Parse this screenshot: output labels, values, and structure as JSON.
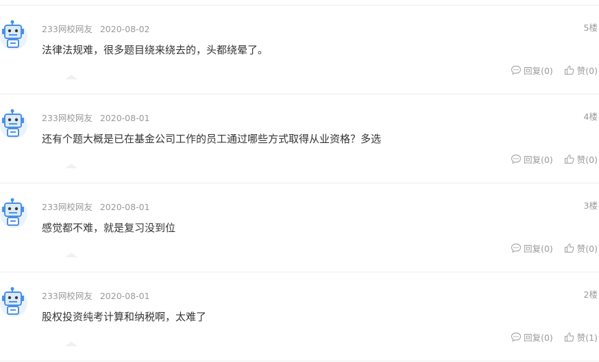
{
  "comments": [
    {
      "user": "233网校网友",
      "date": "2020-08-02",
      "floor": "5楼",
      "text": "法律法规难，很多题目绕来绕去的，头都绕晕了。",
      "reply_label": "回复(0)",
      "like_label": "赞(0)"
    },
    {
      "user": "233网校网友",
      "date": "2020-08-01",
      "floor": "4楼",
      "text": "还有个题大概是已在基金公司工作的员工通过哪些方式取得从业资格？多选",
      "reply_label": "回复(0)",
      "like_label": "赞(0)"
    },
    {
      "user": "233网校网友",
      "date": "2020-08-01",
      "floor": "3楼",
      "text": "感觉都不难，就是复习没到位",
      "reply_label": "回复(0)",
      "like_label": "赞(0)"
    },
    {
      "user": "233网校网友",
      "date": "2020-08-01",
      "floor": "2楼",
      "text": "股权投资纯考计算和纳税啊，太难了",
      "reply_label": "回复(0)",
      "like_label": "赞(1)"
    }
  ],
  "icons": {
    "avatar": "robot-avatar-icon",
    "reply": "comment-bubble-icon",
    "like": "thumbs-up-icon"
  },
  "colors": {
    "meta": "#999999",
    "text": "#333333",
    "separator": "#ececec",
    "avatar_blue": "#4a90e2"
  }
}
